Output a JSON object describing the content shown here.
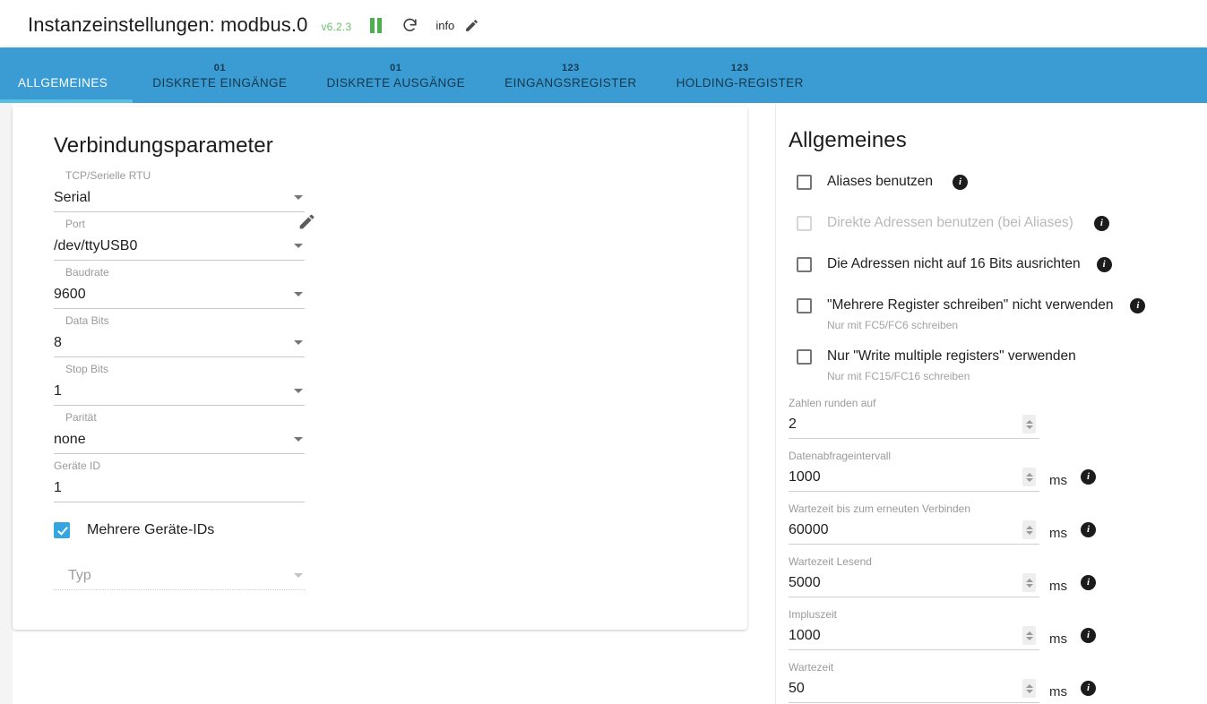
{
  "header": {
    "title": "Instanzeinstellungen: modbus.0",
    "version": "v6.2.3",
    "pause_icon": "pause-icon",
    "refresh_icon": "refresh-icon",
    "info_label": "info",
    "edit_icon": "pencil-icon"
  },
  "tabs": [
    {
      "label": "ALLGEMEINES",
      "badge": "",
      "active": true
    },
    {
      "label": "DISKRETE EINGÄNGE",
      "badge": "01",
      "active": false
    },
    {
      "label": "DISKRETE AUSGÄNGE",
      "badge": "01",
      "active": false
    },
    {
      "label": "EINGANGSREGISTER",
      "badge": "123",
      "active": false
    },
    {
      "label": "HOLDING-REGISTER",
      "badge": "123",
      "active": false
    }
  ],
  "left": {
    "title": "Verbindungsparameter",
    "fields": [
      {
        "label": "TCP/Serielle RTU",
        "value": "Serial",
        "type": "select"
      },
      {
        "label": "Port",
        "value": "/dev/ttyUSB0",
        "type": "select"
      },
      {
        "label": "Baudrate",
        "value": "9600",
        "type": "select"
      },
      {
        "label": "Data Bits",
        "value": "8",
        "type": "select"
      },
      {
        "label": "Stop Bits",
        "value": "1",
        "type": "select"
      },
      {
        "label": "Parität",
        "value": "none",
        "type": "select"
      }
    ],
    "device_id": {
      "label": "Geräte ID",
      "value": "1"
    },
    "multi_ids": {
      "label": "Mehrere Geräte-IDs",
      "checked": true
    },
    "typ_select": {
      "placeholder": "Typ",
      "value": "",
      "disabled": true
    },
    "edit_port_icon": "pencil-icon"
  },
  "right": {
    "title": "Allgemeines",
    "checkboxes": [
      {
        "label": "Aliases benutzen",
        "sub": "",
        "checked": false,
        "disabled": false,
        "info": true
      },
      {
        "label": "Direkte Adressen benutzen (bei Aliases)",
        "sub": "",
        "checked": false,
        "disabled": true,
        "info": true
      },
      {
        "label": "Die Adressen nicht auf 16 Bits ausrichten",
        "sub": "",
        "checked": false,
        "disabled": false,
        "info": true
      },
      {
        "label": "\"Mehrere Register schreiben\" nicht verwenden",
        "sub": "Nur mit FC5/FC6 schreiben",
        "checked": false,
        "disabled": false,
        "info": true
      },
      {
        "label": "Nur \"Write multiple registers\" verwenden",
        "sub": "Nur mit FC15/FC16 schreiben",
        "checked": false,
        "disabled": false,
        "info": false
      }
    ],
    "numbers": [
      {
        "label": "Zahlen runden auf",
        "value": "2",
        "unit": "",
        "info": false
      },
      {
        "label": "Datenabfrageintervall",
        "value": "1000",
        "unit": "ms",
        "info": true
      },
      {
        "label": "Wartezeit bis zum erneuten Verbinden",
        "value": "60000",
        "unit": "ms",
        "info": true
      },
      {
        "label": "Wartezeit Lesend",
        "value": "5000",
        "unit": "ms",
        "info": true
      },
      {
        "label": "Impluszeit",
        "value": "1000",
        "unit": "ms",
        "info": true
      },
      {
        "label": "Wartezeit",
        "value": "50",
        "unit": "ms",
        "info": true
      }
    ],
    "info_glyph": "i"
  },
  "colors": {
    "tab_bar": "#3a9cd2",
    "tab_indicator": "#59c0de",
    "checkbox_checked": "#35a6e0",
    "version_text": "#6abf69",
    "pause_icon": "#4caf50"
  }
}
